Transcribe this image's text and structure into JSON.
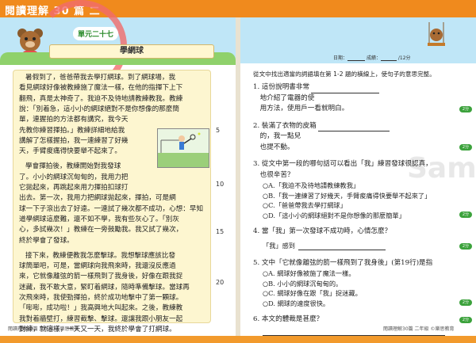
{
  "header": {
    "title": "閱讀理解 30 篇 二"
  },
  "left": {
    "unit": "單元二十七",
    "title": "學網球",
    "paragraphs": [
      [
        "暑假到了，爸爸帶我去學打網球。到了網球場，我",
        "看見網球好像被教練施了魔法一樣，在他的指揮下上下",
        "翻飛，真是太神奇了。我迫不及待地請教練教我。教練",
        "說：「別着急，這小小的網球絕對不是你想像的那麼簡",
        "單，連握拍的方法都有講究，我今天",
        "先教你練習揮拍。」教練詳細地給我",
        "講解了怎樣握拍，我一連練習了好幾",
        "天，手臂痠痛得快要舉不起來了。"
      ],
      [
        "學會揮拍後，教練開始對我發球",
        "了。小小的網球沉甸甸的，我用力把",
        "它拋起來，再跳起來用力揮拍扣球打",
        "出去。第一次，我用力把網球拋起來，揮拍，可是網",
        "球一下子滾出去了好遠。一連試了幾次都不成功，心想：早知",
        "道學網球這麼難，還不如不學，我有些灰心了。「別灰",
        "心，多試幾次！」教練在一旁鼓勵我。我又試了幾次，",
        "終於學會了發球。"
      ],
      [
        "接下來，教練便教我怎麼擊球。我想擊球應該比發",
        "球簡單吧，可是，當網球向我飛來時，我還沒反應過",
        "來，它就像離弦的箭一樣飛到了我身後，好像在跟我捉",
        "迷藏，我不敢大意，緊盯着網球，隨時準備擊球。當球再",
        "次飛來時，我使勁揮拍，終於成功地擊中了第一顆球。",
        "「嘭嘭，成功啦！」我高興地大叫起來。之後，教練教",
        "我對着牆壁打，練習截擊、擊球。還讓我跟小朋友一起",
        "對練，就這樣，一天又一天，我終於學會了打網球。"
      ]
    ],
    "line_numbers": [
      "5",
      "10",
      "15",
      "20"
    ],
    "footer": "閱讀理解30篇 二年級 ©樂思教育"
  },
  "right": {
    "score": {
      "date": "日期：",
      "result": "成績：",
      "total": "/12分"
    },
    "instruction": "從文中找出適當的詞語填在第 1-2 題的橫線上，使句子的意思完整。",
    "questions": [
      {
        "n": "1.",
        "lines": [
          "這份說明書非常",
          "地介紹了電器的使",
          "用方法，使用戶一看就明白。"
        ]
      },
      {
        "n": "2.",
        "lines": [
          "裝滿了衣物的皮箱",
          "的，我一點兒",
          "也提不動。"
        ]
      },
      {
        "n": "3.",
        "lines": [
          "從文中第一段的哪句話可以看出「我」練習發球很認真，",
          "也很辛苦？"
        ],
        "options": [
          "A.「我迫不及待地請教練教我」",
          "B.「我一連練習了好幾天，手臂痠痛得快要舉不起來了」",
          "C.「爸爸帶我去學打網球」",
          "D.「這小小的網球絕對不是你想像的那麼簡單」"
        ]
      },
      {
        "n": "4.",
        "lines": [
          "當「我」第一次發球不成功時，心情怎麼？"
        ],
        "answer": "「我」感到"
      },
      {
        "n": "5.",
        "lines": [
          "文中「它就像離弦的箭一樣飛到了我身後」(第19行)是指"
        ],
        "options": [
          "A. 網球好像被施了魔法一樣。",
          "B. 小小的網球沉甸甸的。",
          "C. 網球好像在跟「我」捉迷藏。",
          "D. 網球的速度很快。"
        ]
      },
      {
        "n": "6.",
        "lines": [
          "本文的體裁是甚麼？"
        ]
      }
    ],
    "points": [
      "2分",
      "2分",
      "2分",
      "2分",
      "2分",
      "2分"
    ],
    "footer": "閱讀理解30篇 二年級 ©樂思教育",
    "watermark": "Sample"
  }
}
